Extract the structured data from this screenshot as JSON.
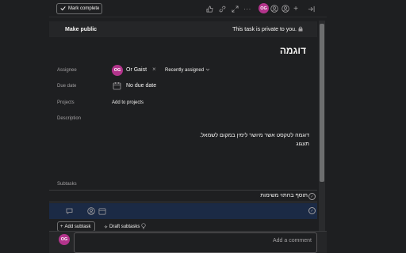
{
  "toolbar": {
    "mark_complete": "Mark complete",
    "avatar_initials": "OG"
  },
  "banner": {
    "make_public": "Make public",
    "private_text": "This task is private to you."
  },
  "task": {
    "title": "דוגמה",
    "labels": {
      "assignee": "Assignee",
      "due_date": "Due date",
      "projects": "Projects",
      "description": "Description",
      "subtasks": "Subtasks"
    },
    "assignee": {
      "initials": "OG",
      "name": "Or Gaist",
      "recently_assigned": "Recently assigned"
    },
    "due_date_value": "No due date",
    "add_to_projects": "Add to projects",
    "description_lines": [
      "דוגמה לטקסט אשר מיושר לימין במקום לשמאל.",
      "תעגוג"
    ]
  },
  "subtasks": {
    "items": [
      "תוסף בחתוי משימות"
    ],
    "add_subtask": "Add subtask",
    "draft_subtasks": "Draft subtasks"
  },
  "comment": {
    "avatar_initials": "OG",
    "placeholder": "Add a comment"
  },
  "colors": {
    "background": "#1e1f21",
    "avatar": "#b3348c",
    "selected_row": "#1b2a45"
  }
}
